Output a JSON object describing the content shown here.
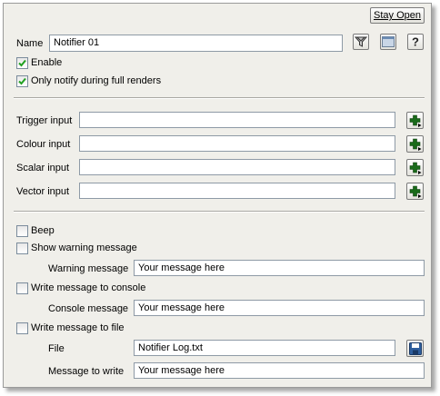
{
  "header": {
    "stay_open_label": "Stay Open"
  },
  "name": {
    "label": "Name",
    "value": "Notifier 01"
  },
  "toolbar_icons": [
    "filter-icon",
    "window-icon",
    "help-icon"
  ],
  "options": {
    "enable_label": "Enable",
    "enable_checked": true,
    "full_renders_label": "Only notify during full renders",
    "full_renders_checked": true
  },
  "inputs": [
    {
      "label": "Trigger input",
      "value": ""
    },
    {
      "label": "Colour input",
      "value": ""
    },
    {
      "label": "Scalar input",
      "value": ""
    },
    {
      "label": "Vector input",
      "value": ""
    }
  ],
  "actions": {
    "beep_label": "Beep",
    "warning_label": "Show warning message",
    "warning_message_label": "Warning message",
    "warning_message_value": "Your message here",
    "console_label": "Write message to console",
    "console_message_label": "Console message",
    "console_message_value": "Your message here",
    "file_label": "Write message to file",
    "file_name_label": "File",
    "file_name_value": "Notifier Log.txt",
    "message_to_write_label": "Message to write",
    "message_to_write_value": "Your message here"
  }
}
